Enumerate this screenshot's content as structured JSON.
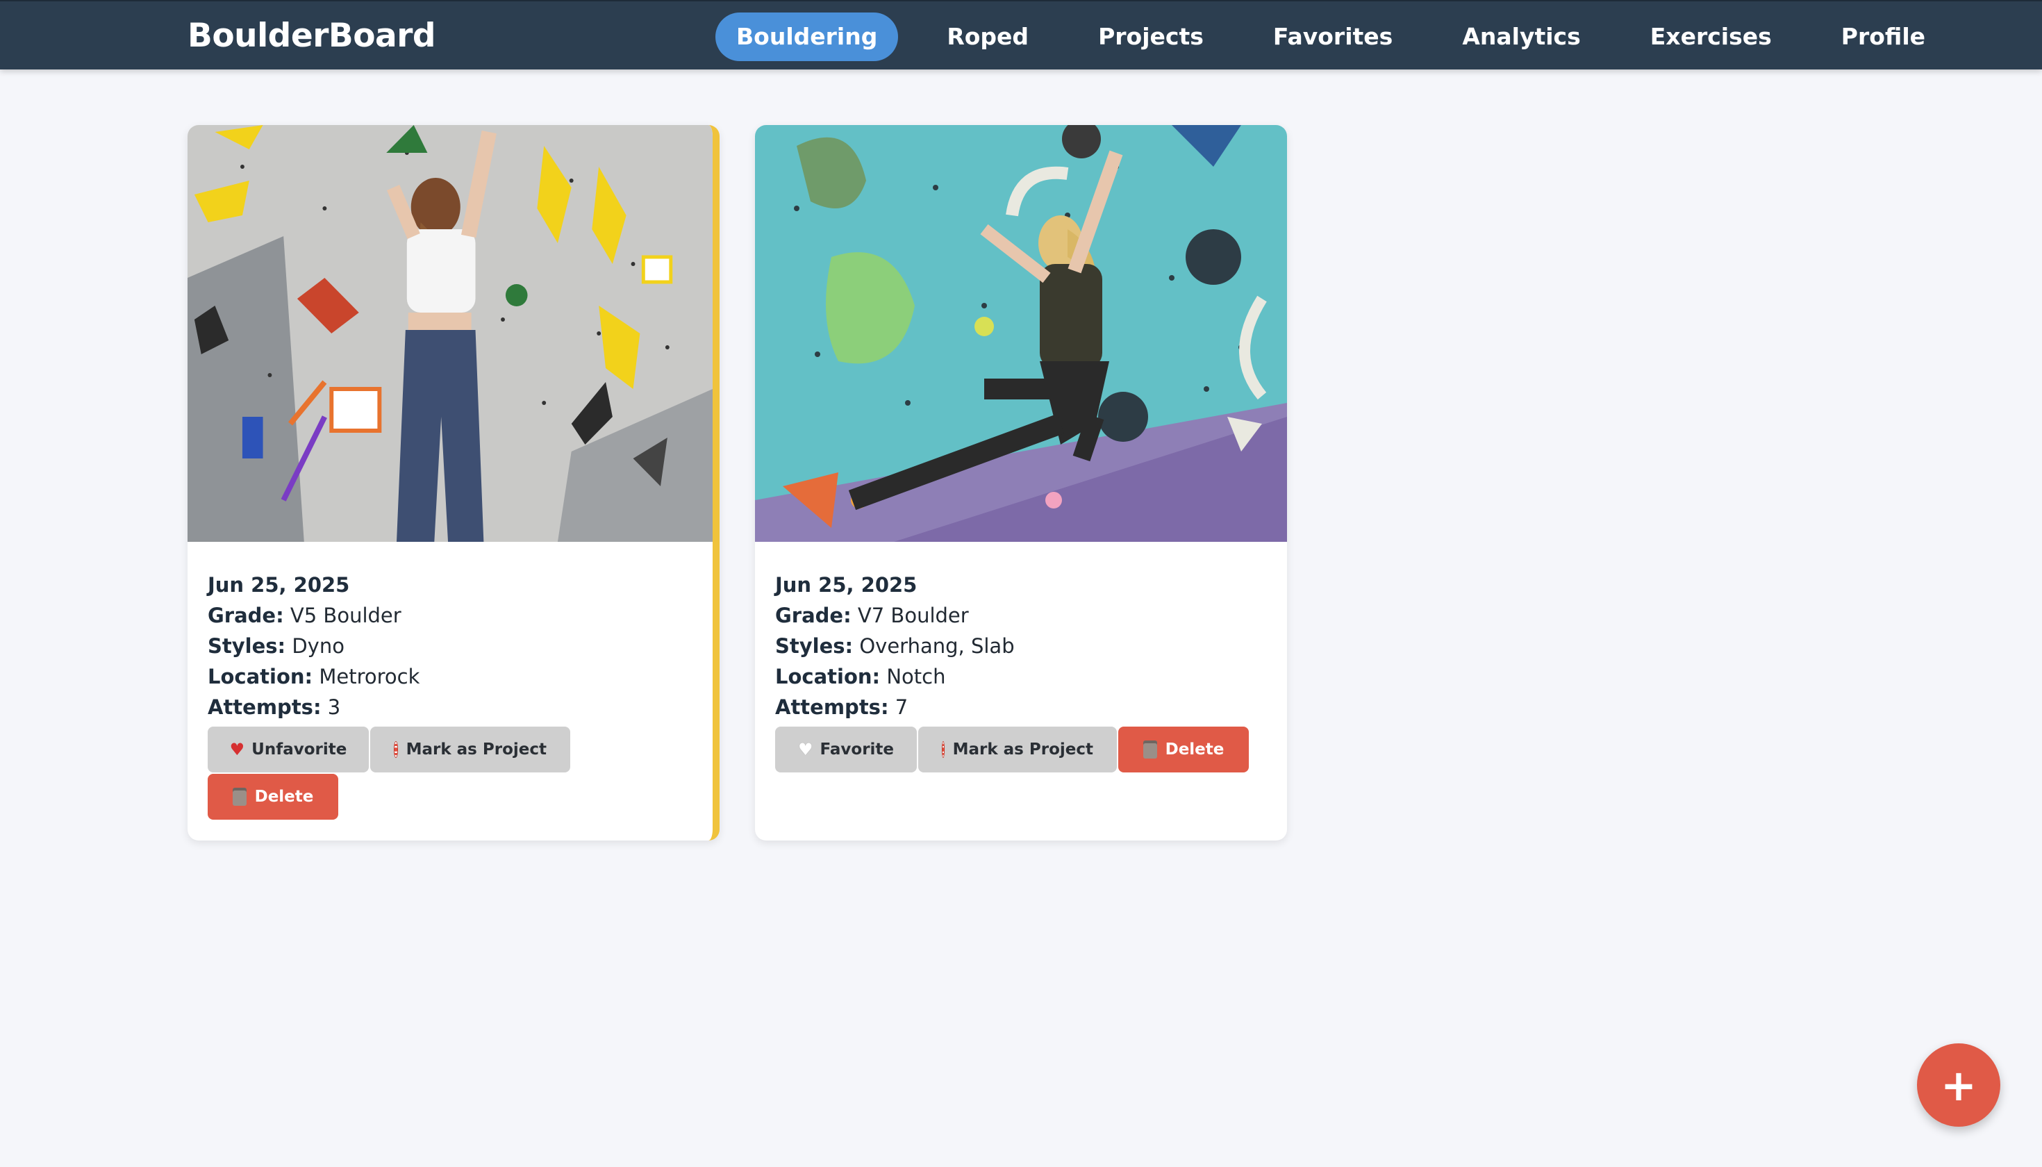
{
  "app": {
    "title": "BoulderBoard"
  },
  "nav": {
    "tabs": [
      {
        "label": "Bouldering",
        "active": true
      },
      {
        "label": "Roped"
      },
      {
        "label": "Projects"
      },
      {
        "label": "Favorites"
      },
      {
        "label": "Analytics"
      },
      {
        "label": "Exercises"
      },
      {
        "label": "Profile"
      }
    ]
  },
  "labels": {
    "grade": "Grade:",
    "styles": "Styles:",
    "location": "Location:",
    "attempts": "Attempts:"
  },
  "climbs": [
    {
      "date": "Jun 25, 2025",
      "grade": "V5 Boulder",
      "styles": "Dyno",
      "location": "Metrorock",
      "attempts": "3",
      "favorite": true,
      "favorite_button": "Unfavorite",
      "project_button": "Mark as Project",
      "delete_button": "Delete"
    },
    {
      "date": "Jun 25, 2025",
      "grade": "V7 Boulder",
      "styles": "Overhang, Slab",
      "location": "Notch",
      "attempts": "7",
      "favorite": false,
      "favorite_button": "Favorite",
      "project_button": "Mark as Project",
      "delete_button": "Delete"
    }
  ],
  "fab": {
    "label": "+"
  },
  "colors": {
    "navbar": "#2c3e50",
    "active_tab": "#4a90d9",
    "favorite_border": "#f0c33c",
    "delete": "#e05a47",
    "secondary_button": "#cfcfcf"
  }
}
